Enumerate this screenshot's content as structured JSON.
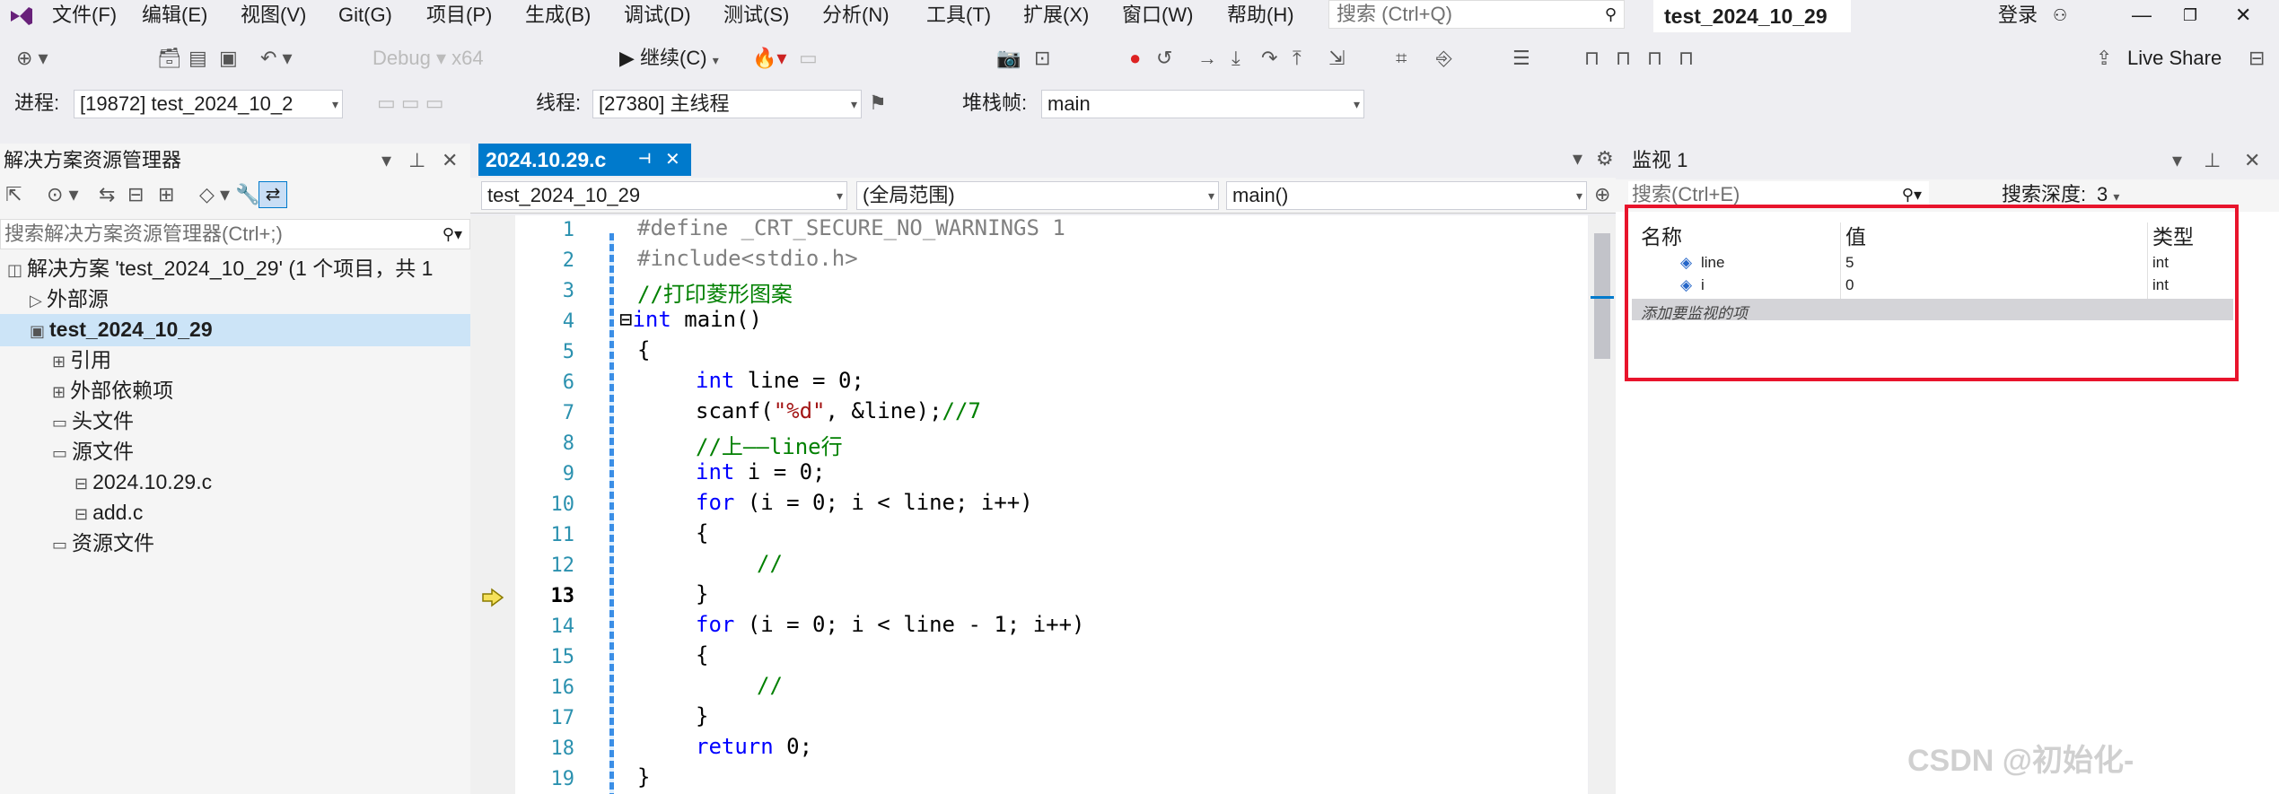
{
  "menu": {
    "items": [
      "文件(F)",
      "编辑(E)",
      "视图(V)",
      "Git(G)",
      "项目(P)",
      "生成(B)",
      "调试(D)",
      "测试(S)",
      "分析(N)",
      "工具(T)",
      "扩展(X)",
      "窗口(W)",
      "帮助(H)"
    ],
    "search_placeholder": "搜索 (Ctrl+Q)",
    "solution_title": "test_2024_10_29",
    "login": "登录"
  },
  "toolbar": {
    "continue_label": "继续(C)",
    "live_share": "Live Share"
  },
  "debugbar": {
    "process_label": "进程:",
    "process_value": "[19872] test_2024_10_2",
    "thread_label": "线程:",
    "thread_value": "[27380] 主线程",
    "stack_label": "堆栈帧:",
    "stack_value": "main"
  },
  "solution_explorer": {
    "title": "解决方案资源管理器",
    "search_placeholder": "搜索解决方案资源管理器(Ctrl+;)",
    "tree": [
      {
        "label": "解决方案 'test_2024_10_29' (1 个项目，共 1",
        "indent": 0,
        "bold": false
      },
      {
        "label": "外部源",
        "indent": 1,
        "bold": false
      },
      {
        "label": "test_2024_10_29",
        "indent": 1,
        "bold": true
      },
      {
        "label": "引用",
        "indent": 2,
        "bold": false
      },
      {
        "label": "外部依赖项",
        "indent": 2,
        "bold": false
      },
      {
        "label": "头文件",
        "indent": 2,
        "bold": false
      },
      {
        "label": "源文件",
        "indent": 2,
        "bold": false
      },
      {
        "label": "2024.10.29.c",
        "indent": 3,
        "bold": false
      },
      {
        "label": "add.c",
        "indent": 3,
        "bold": false
      },
      {
        "label": "资源文件",
        "indent": 2,
        "bold": false
      }
    ]
  },
  "editor": {
    "tab_label": "2024.10.29.c",
    "nav_project": "test_2024_10_29",
    "nav_scope": "(全局范围)",
    "nav_function": "main()",
    "line_numbers": [
      "1",
      "2",
      "3",
      "4",
      "5",
      "6",
      "7",
      "8",
      "9",
      "10",
      "11",
      "12",
      "13",
      "14",
      "15",
      "16",
      "17",
      "18",
      "19"
    ]
  },
  "watch": {
    "title": "监视 1",
    "search_placeholder": "搜索(Ctrl+E)",
    "depth_label": "搜索深度:",
    "depth_value": "3",
    "col_name": "名称",
    "col_value": "值",
    "col_type": "类型",
    "rows": [
      {
        "name": "line",
        "value": "5",
        "type": "int"
      },
      {
        "name": "i",
        "value": "0",
        "type": "int"
      }
    ],
    "add_placeholder": "添加要监视的项"
  },
  "watermark": "CSDN @初始化-",
  "colors": {
    "accent": "#007acc",
    "highlight_border": "#e8142c",
    "keyword": "#0000ff",
    "comment": "#008000"
  }
}
